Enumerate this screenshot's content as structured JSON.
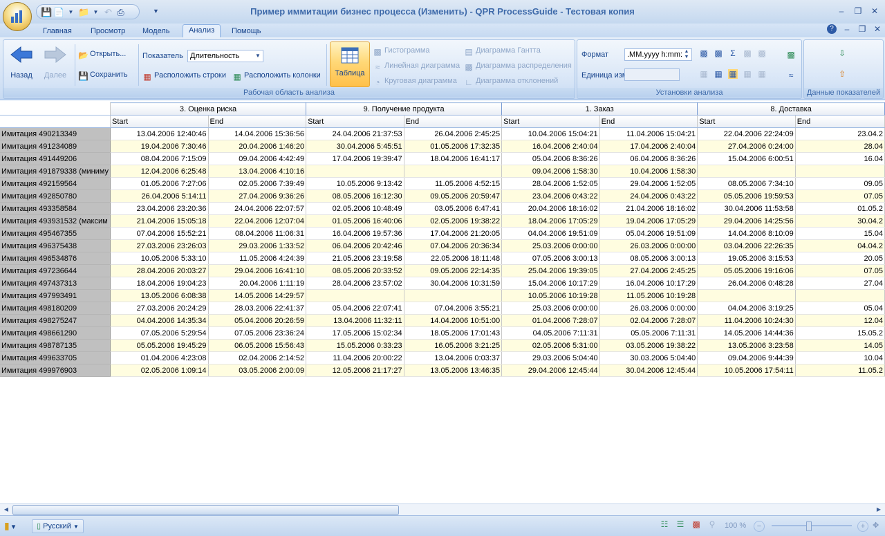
{
  "window": {
    "title": "Пример иммитации бизнес процесса (Изменить) - QPR ProcessGuide - Тестовая копия"
  },
  "tabs": [
    "Главная",
    "Просмотр",
    "Модель",
    "Анализ",
    "Помощь"
  ],
  "active_tab": "Анализ",
  "ribbon": {
    "workspace": {
      "back_label": "Назад",
      "forward_label": "Далее",
      "open_label": "Открыть...",
      "save_label": "Сохранить",
      "indicator_label": "Показатель",
      "indicator_value": "Длительность",
      "arrange_rows_label": "Расположить строки",
      "arrange_cols_label": "Расположить колонки",
      "table_label": "Таблица",
      "histogram_label": "Гистограмма",
      "line_chart_label": "Линейная диаграмма",
      "pie_chart_label": "Круговая диаграмма",
      "gantt_label": "Диаграмма Гантта",
      "distribution_label": "Диаграмма распределения",
      "deviation_label": "Диаграмма отклонений",
      "group_label": "Рабочая область анализа"
    },
    "settings": {
      "format_label": "Формат",
      "format_value": ".MM.yyyy h:mm:",
      "unit_label": "Единица изм",
      "group_label": "Установки анализа"
    },
    "data": {
      "group_label": "Данные показателей"
    }
  },
  "grid": {
    "groups": [
      "3. Оценка риска",
      "9. Получение продукта",
      "1. Заказ",
      "8. Доставка"
    ],
    "subheaders": [
      "Start",
      "End",
      "Start",
      "End",
      "Start",
      "End",
      "Start",
      "End"
    ],
    "rows": [
      {
        "name": "Имитация 490213349",
        "cells": [
          "13.04.2006 12:40:46",
          "14.04.2006 15:36:56",
          "24.04.2006 21:37:53",
          "26.04.2006 2:45:25",
          "10.04.2006 15:04:21",
          "11.04.2006 15:04:21",
          "22.04.2006 22:24:09",
          "23.04.2"
        ]
      },
      {
        "name": "Имитация 491234089",
        "cells": [
          "19.04.2006 7:30:46",
          "20.04.2006 1:46:20",
          "30.04.2006 5:45:51",
          "01.05.2006 17:32:35",
          "16.04.2006 2:40:04",
          "17.04.2006 2:40:04",
          "27.04.2006 0:24:00",
          "28.04"
        ]
      },
      {
        "name": "Имитация 491449206",
        "cells": [
          "08.04.2006 7:15:09",
          "09.04.2006 4:42:49",
          "17.04.2006 19:39:47",
          "18.04.2006 16:41:17",
          "05.04.2006 8:36:26",
          "06.04.2006 8:36:26",
          "15.04.2006 6:00:51",
          "16.04"
        ]
      },
      {
        "name": "Имитация 491879338 (миниму",
        "cells": [
          "12.04.2006 6:25:48",
          "13.04.2006 4:10:16",
          "",
          "",
          "09.04.2006 1:58:30",
          "10.04.2006 1:58:30",
          "",
          ""
        ]
      },
      {
        "name": "Имитация 492159564",
        "cells": [
          "01.05.2006 7:27:06",
          "02.05.2006 7:39:49",
          "10.05.2006 9:13:42",
          "11.05.2006 4:52:15",
          "28.04.2006 1:52:05",
          "29.04.2006 1:52:05",
          "08.05.2006 7:34:10",
          "09.05"
        ]
      },
      {
        "name": "Имитация 492850780",
        "cells": [
          "26.04.2006 5:14:11",
          "27.04.2006 9:36:26",
          "08.05.2006 16:12:30",
          "09.05.2006 20:59:47",
          "23.04.2006 0:43:22",
          "24.04.2006 0:43:22",
          "05.05.2006 19:59:53",
          "07.05"
        ]
      },
      {
        "name": "Имитация 493358584",
        "cells": [
          "23.04.2006 23:20:36",
          "24.04.2006 22:07:57",
          "02.05.2006 10:48:49",
          "03.05.2006 6:47:41",
          "20.04.2006 18:16:02",
          "21.04.2006 18:16:02",
          "30.04.2006 11:53:58",
          "01.05.2"
        ]
      },
      {
        "name": "Имитация 493931532 (максим",
        "cells": [
          "21.04.2006 15:05:18",
          "22.04.2006 12:07:04",
          "01.05.2006 16:40:06",
          "02.05.2006 19:38:22",
          "18.04.2006 17:05:29",
          "19.04.2006 17:05:29",
          "29.04.2006 14:25:56",
          "30.04.2"
        ]
      },
      {
        "name": "Имитация 495467355",
        "cells": [
          "07.04.2006 15:52:21",
          "08.04.2006 11:06:31",
          "16.04.2006 19:57:36",
          "17.04.2006 21:20:05",
          "04.04.2006 19:51:09",
          "05.04.2006 19:51:09",
          "14.04.2006 8:10:09",
          "15.04"
        ]
      },
      {
        "name": "Имитация 496375438",
        "cells": [
          "27.03.2006 23:26:03",
          "29.03.2006 1:33:52",
          "06.04.2006 20:42:46",
          "07.04.2006 20:36:34",
          "25.03.2006 0:00:00",
          "26.03.2006 0:00:00",
          "03.04.2006 22:26:35",
          "04.04.2"
        ]
      },
      {
        "name": "Имитация 496534876",
        "cells": [
          "10.05.2006 5:33:10",
          "11.05.2006 4:24:39",
          "21.05.2006 23:19:58",
          "22.05.2006 18:11:48",
          "07.05.2006 3:00:13",
          "08.05.2006 3:00:13",
          "19.05.2006 3:15:53",
          "20.05"
        ]
      },
      {
        "name": "Имитация 497236644",
        "cells": [
          "28.04.2006 20:03:27",
          "29.04.2006 16:41:10",
          "08.05.2006 20:33:52",
          "09.05.2006 22:14:35",
          "25.04.2006 19:39:05",
          "27.04.2006 2:45:25",
          "05.05.2006 19:16:06",
          "07.05"
        ]
      },
      {
        "name": "Имитация 497437313",
        "cells": [
          "18.04.2006 19:04:23",
          "20.04.2006 1:11:19",
          "28.04.2006 23:57:02",
          "30.04.2006 10:31:59",
          "15.04.2006 10:17:29",
          "16.04.2006 10:17:29",
          "26.04.2006 0:48:28",
          "27.04"
        ]
      },
      {
        "name": "Имитация 497993491",
        "cells": [
          "13.05.2006 6:08:38",
          "14.05.2006 14:29:57",
          "",
          "",
          "10.05.2006 10:19:28",
          "11.05.2006 10:19:28",
          "",
          ""
        ]
      },
      {
        "name": "Имитация 498180209",
        "cells": [
          "27.03.2006 20:24:29",
          "28.03.2006 22:41:37",
          "05.04.2006 22:07:41",
          "07.04.2006 3:55:21",
          "25.03.2006 0:00:00",
          "26.03.2006 0:00:00",
          "04.04.2006 3:19:25",
          "05.04"
        ]
      },
      {
        "name": "Имитация 498275247",
        "cells": [
          "04.04.2006 14:35:34",
          "05.04.2006 20:26:59",
          "13.04.2006 11:32:11",
          "14.04.2006 10:51:00",
          "01.04.2006 7:28:07",
          "02.04.2006 7:28:07",
          "11.04.2006 10:24:30",
          "12.04"
        ]
      },
      {
        "name": "Имитация 498661290",
        "cells": [
          "07.05.2006 5:29:54",
          "07.05.2006 23:36:24",
          "17.05.2006 15:02:34",
          "18.05.2006 17:01:43",
          "04.05.2006 7:11:31",
          "05.05.2006 7:11:31",
          "14.05.2006 14:44:36",
          "15.05.2"
        ]
      },
      {
        "name": "Имитация 498787135",
        "cells": [
          "05.05.2006 19:45:29",
          "06.05.2006 15:56:43",
          "15.05.2006 0:33:23",
          "16.05.2006 3:21:25",
          "02.05.2006 5:31:00",
          "03.05.2006 19:38:22",
          "13.05.2006 3:23:58",
          "14.05"
        ]
      },
      {
        "name": "Имитация 499633705",
        "cells": [
          "01.04.2006 4:23:08",
          "02.04.2006 2:14:52",
          "11.04.2006 20:00:22",
          "13.04.2006 0:03:37",
          "29.03.2006 5:04:40",
          "30.03.2006 5:04:40",
          "09.04.2006 9:44:39",
          "10.04"
        ]
      },
      {
        "name": "Имитация 499976903",
        "cells": [
          "02.05.2006 1:09:14",
          "03.05.2006 2:00:09",
          "12.05.2006 21:17:27",
          "13.05.2006 13:46:35",
          "29.04.2006 12:45:44",
          "30.04.2006 12:45:44",
          "10.05.2006 17:54:11",
          "11.05.2"
        ]
      }
    ]
  },
  "status": {
    "language": "Русский",
    "zoom": "100 %"
  }
}
